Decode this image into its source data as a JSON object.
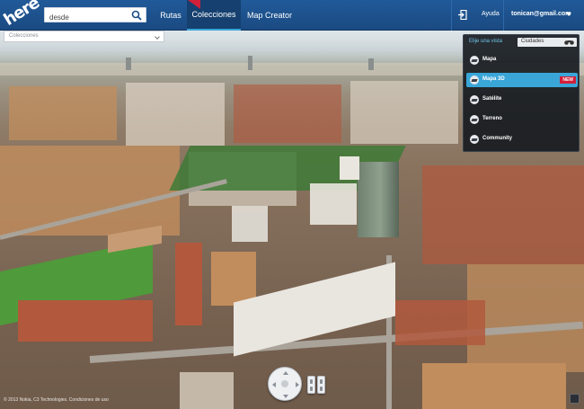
{
  "header": {
    "logo": "here",
    "search_value": "desde",
    "nav": {
      "rutas": "Rutas",
      "colecciones": "Colecciones",
      "map_creator": "Map Creator"
    },
    "help": "Ayuda",
    "user_email": "tonican@gmail.com"
  },
  "collections_dropdown": {
    "value": "Colecciones"
  },
  "view_panel": {
    "title": "Elije una vista",
    "city_dropdown": "Ciudades",
    "options": [
      {
        "label": "Mapa",
        "active": false,
        "badge": ""
      },
      {
        "label": "Mapa 3D",
        "active": true,
        "badge": "NEW"
      },
      {
        "label": "Satélite",
        "active": false,
        "badge": ""
      },
      {
        "label": "Terreno",
        "active": false,
        "badge": ""
      },
      {
        "label": "Community",
        "active": false,
        "badge": ""
      }
    ]
  },
  "map": {
    "copyright": "© 2013 Nokia, C3 Technologies. Condiciones de uso",
    "view": "3d-city-aerial"
  },
  "colors": {
    "header": "#1b4f8a",
    "accent": "#3aa6d8",
    "new_badge": "#d2203a"
  }
}
